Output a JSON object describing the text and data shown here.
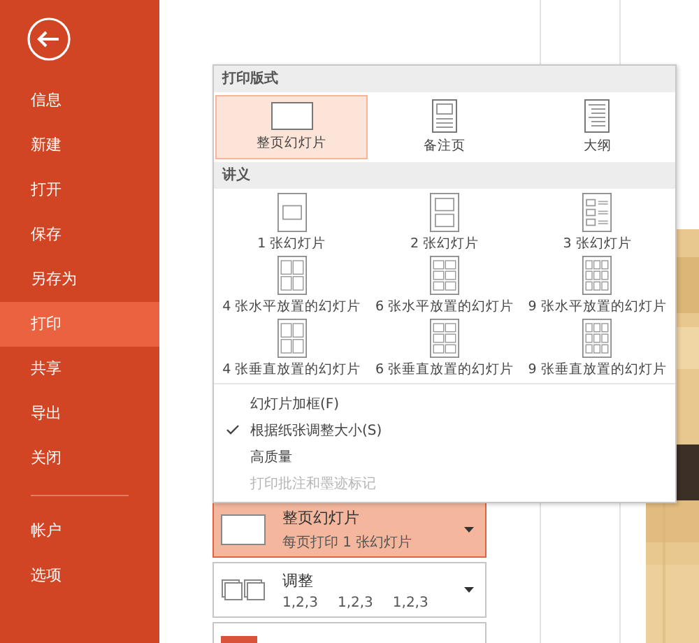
{
  "sidebar": {
    "items": [
      {
        "label": "信息",
        "selected": false
      },
      {
        "label": "新建",
        "selected": false
      },
      {
        "label": "打开",
        "selected": false
      },
      {
        "label": "保存",
        "selected": false
      },
      {
        "label": "另存为",
        "selected": false
      },
      {
        "label": "打印",
        "selected": true
      },
      {
        "label": "共享",
        "selected": false
      },
      {
        "label": "导出",
        "selected": false
      },
      {
        "label": "关闭",
        "selected": false
      }
    ],
    "bottom_items": [
      {
        "label": "帐户",
        "selected": false
      },
      {
        "label": "选项",
        "selected": false
      }
    ]
  },
  "menu": {
    "layout_header": "打印版式",
    "layouts": [
      {
        "kind": "full",
        "label": "整页幻灯片",
        "selected": true
      },
      {
        "kind": "notes",
        "label": "备注页",
        "selected": false
      },
      {
        "kind": "outline",
        "label": "大纲",
        "selected": false
      }
    ],
    "handout_header": "讲义",
    "handouts": [
      {
        "kind": "one",
        "label": "1 张幻灯片",
        "selected": false
      },
      {
        "kind": "two",
        "label": "2 张幻灯片",
        "selected": false
      },
      {
        "kind": "three",
        "label": "3 张幻灯片",
        "selected": false
      },
      {
        "kind": "four-h",
        "label": "4 张水平放置的幻灯片",
        "selected": false
      },
      {
        "kind": "six-h",
        "label": "6 张水平放置的幻灯片",
        "selected": false
      },
      {
        "kind": "nine-h",
        "label": "9 张水平放置的幻灯片",
        "selected": false
      },
      {
        "kind": "four-v",
        "label": "4 张垂直放置的幻灯片",
        "selected": false
      },
      {
        "kind": "six-v",
        "label": "6 张垂直放置的幻灯片",
        "selected": false
      },
      {
        "kind": "nine-v",
        "label": "9 张垂直放置的幻灯片",
        "selected": false
      }
    ],
    "options": [
      {
        "label": "幻灯片加框(F)",
        "checked": false,
        "disabled": false
      },
      {
        "label": "根据纸张调整大小(S)",
        "checked": true,
        "disabled": false
      },
      {
        "label": "高质量",
        "checked": false,
        "disabled": false
      },
      {
        "label": "打印批注和墨迹标记",
        "checked": false,
        "disabled": true
      }
    ]
  },
  "settings": [
    {
      "kind": "layout",
      "title": "整页幻灯片",
      "subtitle": "每页打印 1 张幻灯片",
      "selected": true
    },
    {
      "kind": "collate",
      "title": "调整",
      "parts": [
        "1,2,3",
        "1,2,3",
        "1,2,3"
      ],
      "selected": false
    },
    {
      "kind": "color",
      "selected": false
    }
  ]
}
